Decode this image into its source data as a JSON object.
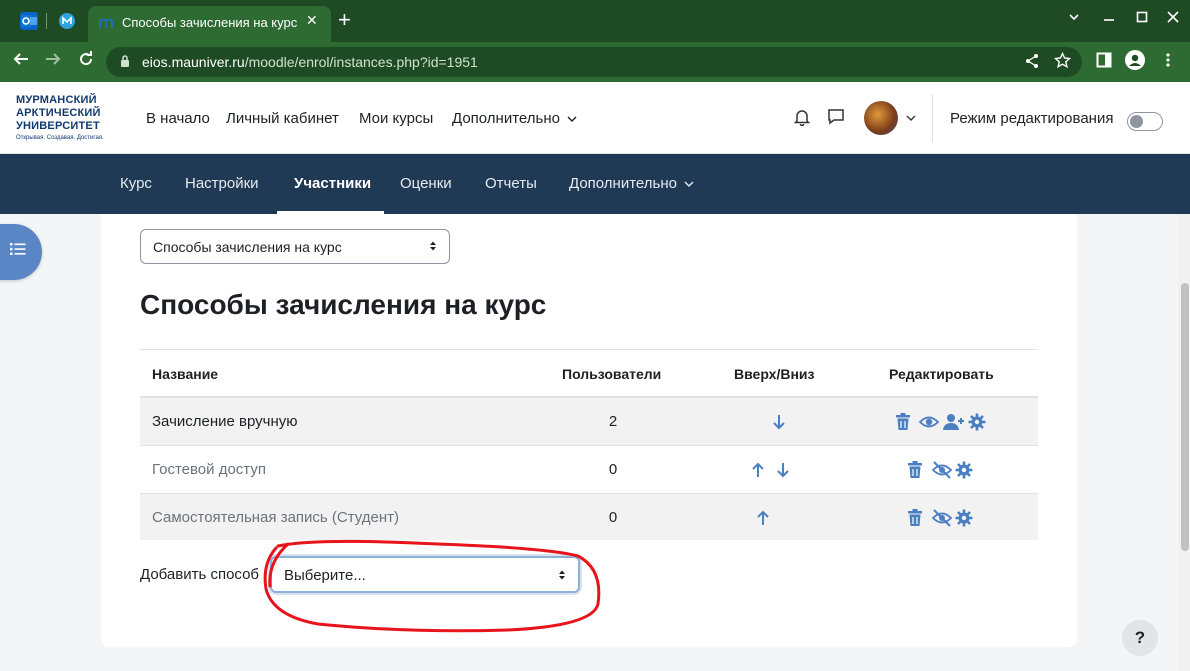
{
  "browser": {
    "tab_title": "Способы зачисления на курс",
    "url_host": "eios.mauniver.ru",
    "url_path": "/moodle/enrol/instances.php?id=1951",
    "theme_color": "#2e6b33"
  },
  "site": {
    "logo_lines": [
      "МУРМАНСКИЙ",
      "АРКТИЧЕСКИЙ",
      "УНИВЕРСИТЕТ"
    ],
    "logo_tagline": "Открывая. Создавая. Достигая.",
    "primary_nav": [
      "В начало",
      "Личный кабинет",
      "Мои курсы",
      "Дополнительно"
    ],
    "edit_mode_label": "Режим редактирования",
    "edit_mode_on": false
  },
  "secondary_nav": {
    "items": [
      "Курс",
      "Настройки",
      "Участники",
      "Оценки",
      "Отчеты",
      "Дополнительно"
    ],
    "active": "Участники",
    "bg_color": "#203a56"
  },
  "page": {
    "jump_select_value": "Способы зачисления на курс",
    "title": "Способы зачисления на курс"
  },
  "table": {
    "headers": [
      "Название",
      "Пользователи",
      "Вверх/Вниз",
      "Редактировать"
    ],
    "rows": [
      {
        "name": "Зачисление вручную",
        "users": "2",
        "arrows": [
          "down-arrow-icon"
        ],
        "actions": [
          "trash-icon",
          "eye-icon",
          "add-user-icon",
          "gear-icon"
        ],
        "enabled": true
      },
      {
        "name": "Гостевой доступ",
        "users": "0",
        "arrows": [
          "up-arrow-icon",
          "down-arrow-icon"
        ],
        "actions": [
          "trash-icon",
          "eye-slash-icon",
          "gear-icon"
        ],
        "enabled": false
      },
      {
        "name": "Самостоятельная запись (Студент)",
        "users": "0",
        "arrows": [
          "up-arrow-icon"
        ],
        "actions": [
          "trash-icon",
          "eye-slash-icon",
          "gear-icon"
        ],
        "enabled": false
      }
    ],
    "icon_color": "#4a7fc1"
  },
  "add_method": {
    "label": "Добавить способ",
    "select_value": "Выберите..."
  },
  "annotation_color": "#e8141c",
  "help_label": "?"
}
